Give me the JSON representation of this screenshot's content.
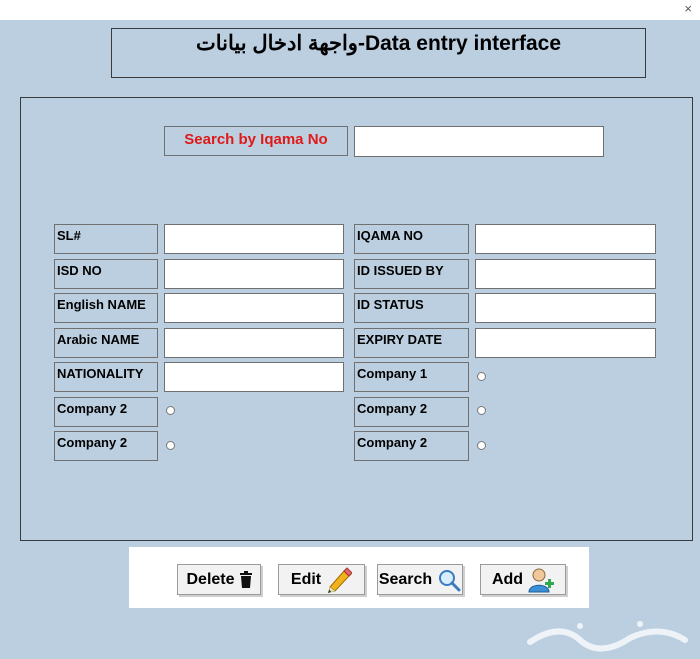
{
  "window": {
    "close_glyph": "×"
  },
  "title": "واجهة ادخال بيانات-Data entry interface",
  "search": {
    "label": "Search by Iqama No",
    "value": ""
  },
  "fields": {
    "sl": {
      "label": "SL#",
      "value": ""
    },
    "isd_no": {
      "label": "ISD NO",
      "value": ""
    },
    "english_name": {
      "label": "English NAME",
      "value": ""
    },
    "arabic_name": {
      "label": "Arabic NAME",
      "value": ""
    },
    "nationality": {
      "label": "NATIONALITY",
      "value": ""
    },
    "company_2_left_a": {
      "label": "Company 2"
    },
    "company_2_left_b": {
      "label": "Company 2"
    },
    "iqama_no": {
      "label": "IQAMA NO",
      "value": ""
    },
    "id_issued_by": {
      "label": "ID ISSUED BY",
      "value": ""
    },
    "id_status": {
      "label": "ID STATUS",
      "value": ""
    },
    "expiry_date": {
      "label": "EXPIRY DATE",
      "value": ""
    },
    "company_1_right": {
      "label": "Company 1"
    },
    "company_2_right_a": {
      "label": "Company 2"
    },
    "company_2_right_b": {
      "label": "Company 2"
    }
  },
  "buttons": {
    "delete": "Delete",
    "edit": "Edit",
    "search": "Search",
    "add": "Add"
  },
  "icons": {
    "delete": "trash-icon",
    "edit": "pencil-icon",
    "search": "magnifier-icon",
    "add": "add-user-icon"
  },
  "colors": {
    "background": "#bccfe0",
    "search_label": "#e01919",
    "border": "#707070"
  }
}
